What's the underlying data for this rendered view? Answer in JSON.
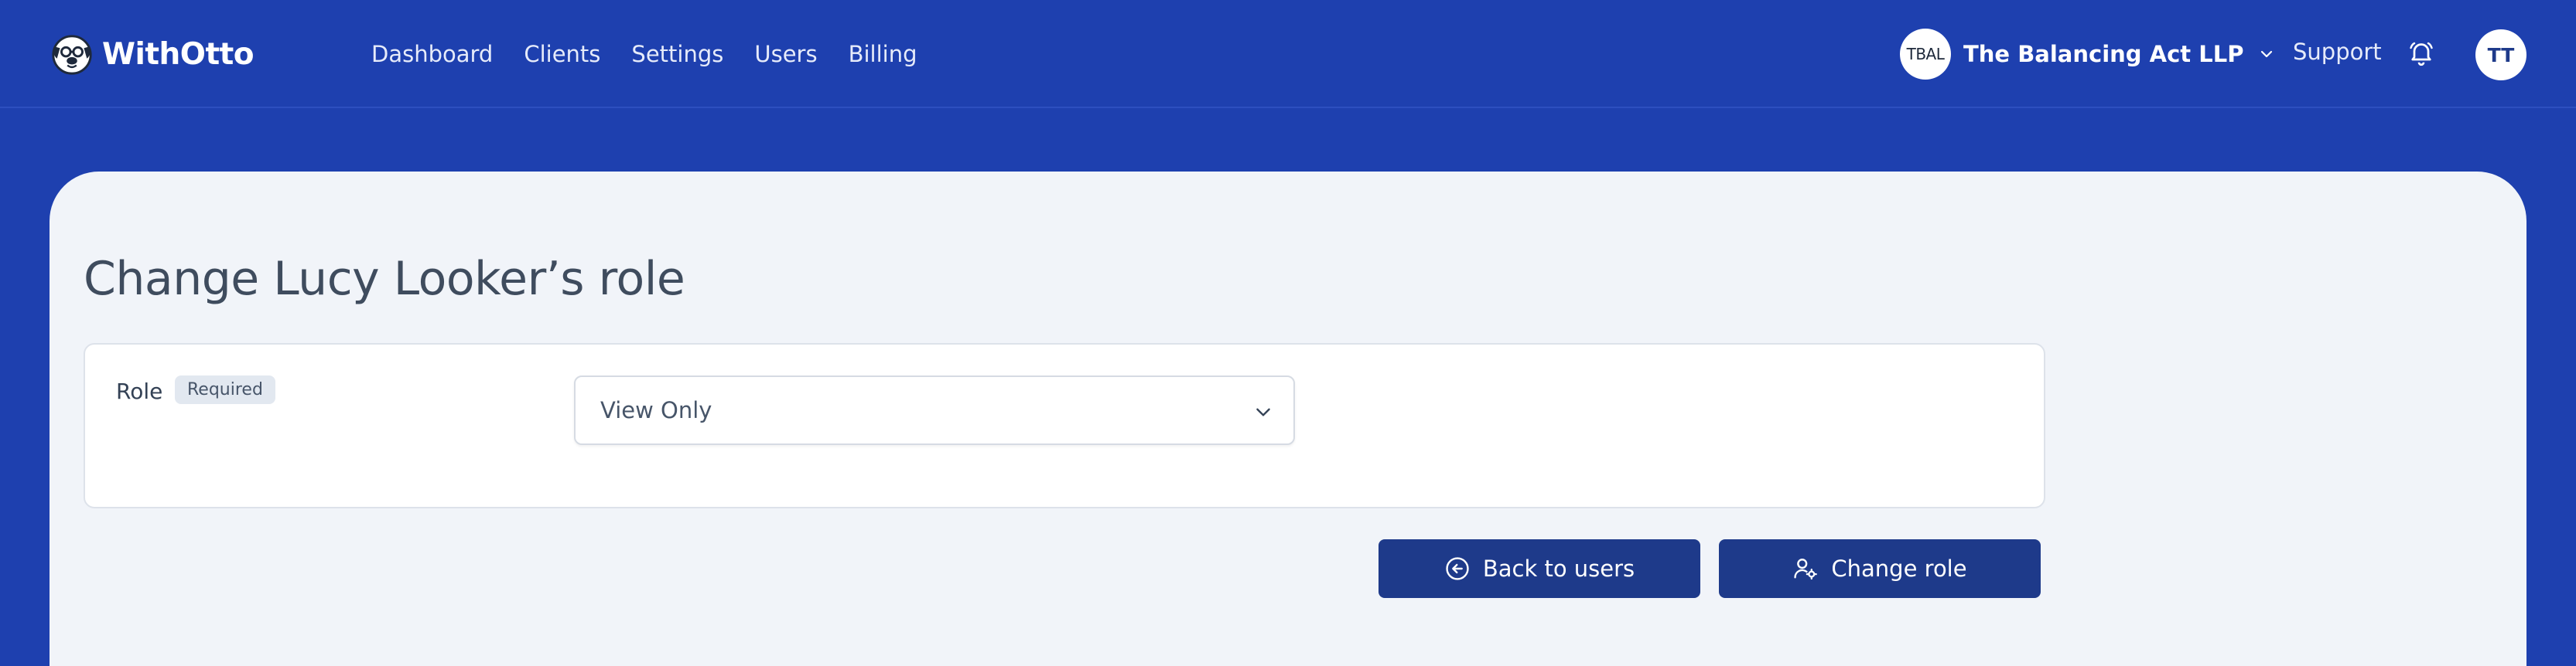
{
  "header": {
    "brand": "WithOtto",
    "nav": [
      "Dashboard",
      "Clients",
      "Settings",
      "Users",
      "Billing"
    ],
    "org": {
      "initials": "TBAL",
      "name": "The Balancing Act LLP"
    },
    "support": "Support",
    "user_initials": "TT"
  },
  "page": {
    "title": "Change Lucy Looker’s role",
    "field": {
      "label": "Role",
      "badge": "Required",
      "value": "View Only"
    },
    "actions": {
      "back": "Back to users",
      "change": "Change role"
    }
  },
  "icons": {
    "brand": "pug-logo-icon",
    "org_chevron": "chevron-down-icon",
    "notifications": "bell-icon",
    "select_chevron": "chevron-down-icon",
    "back": "arrow-left-circle-icon",
    "change": "user-gear-icon"
  },
  "colors": {
    "header_bg": "#1e40af",
    "panel_bg": "#f1f4f9",
    "button_bg": "#1e3a8a",
    "title_text": "#3f4c5e"
  }
}
